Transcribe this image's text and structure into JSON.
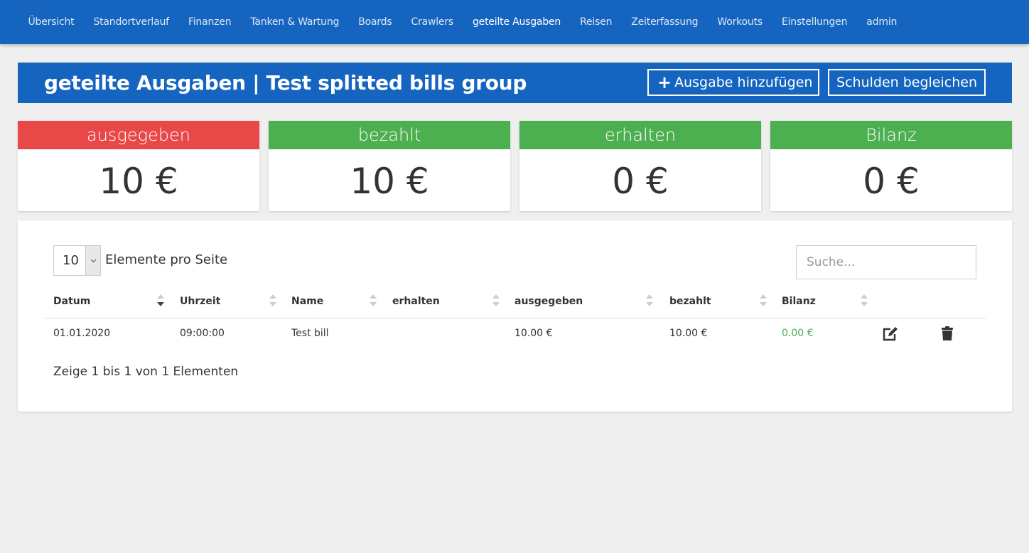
{
  "nav": {
    "items": [
      {
        "label": "Übersicht",
        "name": "nav-uebersicht"
      },
      {
        "label": "Standortverlauf",
        "name": "nav-standortverlauf"
      },
      {
        "label": "Finanzen",
        "name": "nav-finanzen"
      },
      {
        "label": "Tanken & Wartung",
        "name": "nav-tanken-wartung"
      },
      {
        "label": "Boards",
        "name": "nav-boards"
      },
      {
        "label": "Crawlers",
        "name": "nav-crawlers"
      },
      {
        "label": "geteilte Ausgaben",
        "name": "nav-geteilte-ausgaben",
        "active": true
      },
      {
        "label": "Reisen",
        "name": "nav-reisen"
      },
      {
        "label": "Zeiterfassung",
        "name": "nav-zeiterfassung"
      },
      {
        "label": "Workouts",
        "name": "nav-workouts"
      },
      {
        "label": "Einstellungen",
        "name": "nav-einstellungen"
      },
      {
        "label": "admin",
        "name": "nav-admin"
      }
    ]
  },
  "header": {
    "title": "geteilte Ausgaben | Test splitted bills group",
    "add_button": "Ausgabe hinzufügen",
    "add_icon": "+",
    "settle_button": "Schulden begleichen"
  },
  "cards": [
    {
      "label": "ausgegeben",
      "value": "10 €",
      "color": "#e84848"
    },
    {
      "label": "bezahlt",
      "value": "10 €",
      "color": "#4caf50"
    },
    {
      "label": "erhalten",
      "value": "0 €",
      "color": "#4caf50"
    },
    {
      "label": "Bilanz",
      "value": "0 €",
      "color": "#4caf50"
    }
  ],
  "table": {
    "length_value": "10",
    "length_label": "Elemente pro Seite",
    "search_placeholder": "Suche...",
    "columns": [
      "Datum",
      "Uhrzeit",
      "Name",
      "erhalten",
      "ausgegeben",
      "bezahlt",
      "Bilanz"
    ],
    "sorted_column": "Datum",
    "sort_direction": "descending",
    "rows": [
      {
        "datum": "01.01.2020",
        "uhrzeit": "09:00:00",
        "name": "Test bill",
        "erhalten": "",
        "ausgegeben": "10.00 €",
        "bezahlt": "10.00 €",
        "bilanz": "0.00 €",
        "bilanz_color": "#4caf50"
      }
    ],
    "info": "Zeige 1 bis 1 von 1 Elementen"
  }
}
